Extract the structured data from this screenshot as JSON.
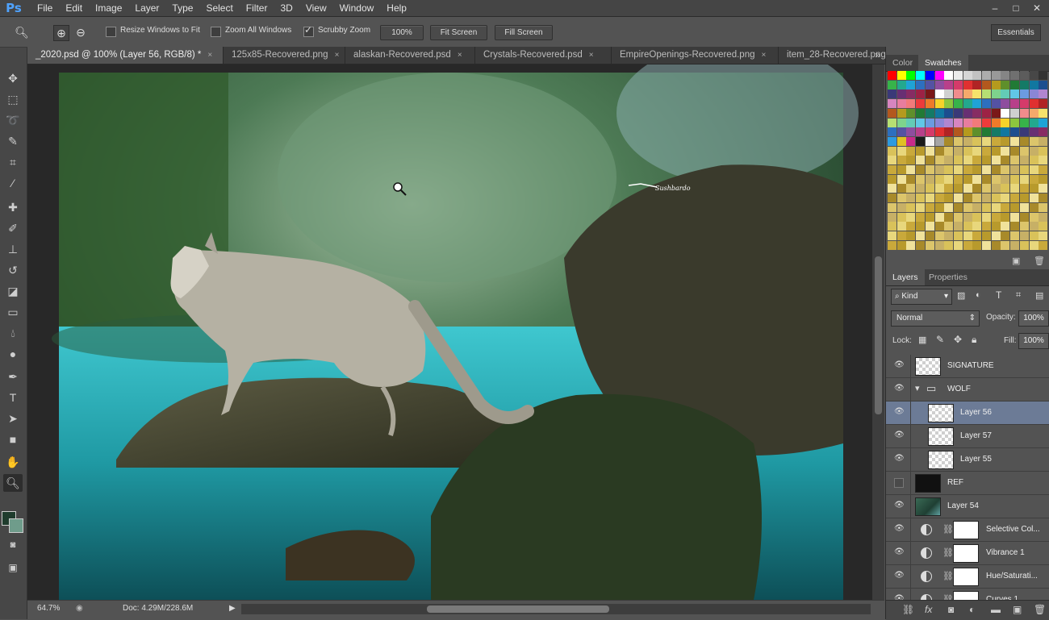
{
  "app": {
    "logo": "Ps"
  },
  "menu": [
    "File",
    "Edit",
    "Image",
    "Layer",
    "Type",
    "Select",
    "Filter",
    "3D",
    "View",
    "Window",
    "Help"
  ],
  "window_controls": [
    "–",
    "□",
    "✕"
  ],
  "options_bar": {
    "resize_windows_label": "Resize Windows to Fit",
    "zoom_all_label": "Zoom All Windows",
    "scrubby_label": "Scrubby Zoom",
    "zoom_100_label": "100%",
    "fit_screen_label": "Fit Screen",
    "fill_screen_label": "Fill Screen",
    "workspace_label": "Essentials"
  },
  "tabs": [
    {
      "label": "_2020.psd @ 100% (Layer 56, RGB/8) *",
      "active": true
    },
    {
      "label": "125x85-Recovered.png",
      "active": false
    },
    {
      "label": "alaskan-Recovered.psd",
      "active": false
    },
    {
      "label": "Crystals-Recovered.psd",
      "active": false
    },
    {
      "label": "EmpireOpenings-Recovered.png",
      "active": false
    },
    {
      "label": "item_28-Recovered.png",
      "active": false
    }
  ],
  "tab_overflow": "»",
  "canvas": {
    "signature_text": "Sushbardo"
  },
  "status": {
    "zoom": "64.7%",
    "doc": "Doc: 4.29M/228.6M"
  },
  "swatch_panel": {
    "tab_color": "Color",
    "tab_swatches": "Swatches"
  },
  "layers_panel": {
    "tab_layers": "Layers",
    "tab_properties": "Properties",
    "kind_label": "Kind",
    "blend_mode": "Normal",
    "opacity_label": "Opacity:",
    "opacity_value": "100%",
    "lock_label": "Lock:",
    "fill_label": "Fill:",
    "fill_value": "100%",
    "layers": [
      {
        "name": "SIGNATURE",
        "type": "pixel",
        "visible": true,
        "selected": false,
        "indent": 0
      },
      {
        "name": "WOLF",
        "type": "group",
        "visible": true,
        "selected": false,
        "indent": 0
      },
      {
        "name": "Layer 56",
        "type": "pixel",
        "visible": true,
        "selected": true,
        "indent": 1
      },
      {
        "name": "Layer 57",
        "type": "pixel",
        "visible": true,
        "selected": false,
        "indent": 1
      },
      {
        "name": "Layer 55",
        "type": "pixel",
        "visible": true,
        "selected": false,
        "indent": 1
      },
      {
        "name": "REF",
        "type": "pixel",
        "visible": false,
        "selected": false,
        "indent": 0
      },
      {
        "name": "Layer 54",
        "type": "image",
        "visible": true,
        "selected": false,
        "indent": 0
      },
      {
        "name": "Selective Col...",
        "type": "adjustment",
        "visible": true,
        "selected": false,
        "indent": 0
      },
      {
        "name": "Vibrance 1",
        "type": "adjustment",
        "visible": true,
        "selected": false,
        "indent": 0
      },
      {
        "name": "Hue/Saturati...",
        "type": "adjustment",
        "visible": true,
        "selected": false,
        "indent": 0
      },
      {
        "name": "Curves 1",
        "type": "adjustment",
        "visible": true,
        "selected": false,
        "indent": 0
      }
    ]
  }
}
